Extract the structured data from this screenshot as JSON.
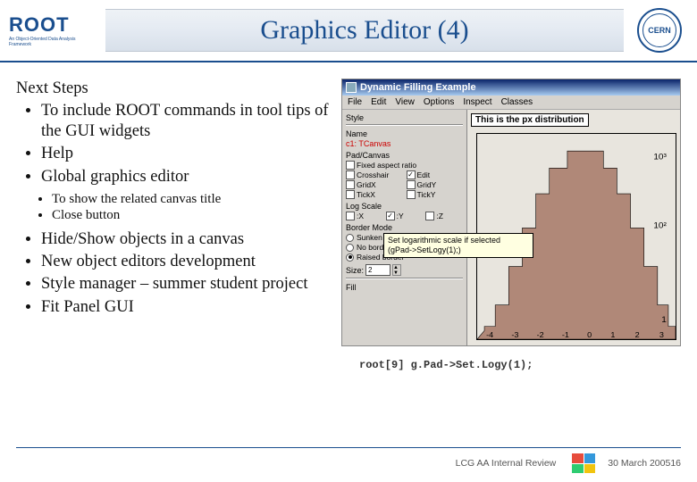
{
  "header": {
    "logo_text": "ROOT",
    "logo_sub": "An Object-Oriented Data Analysis Framework",
    "title": "Graphics Editor (4)",
    "right_logo": "CERN"
  },
  "left": {
    "heading": "Next Steps",
    "bullets": [
      "To include  ROOT commands in tool tips of the GUI widgets",
      "Help",
      "Global graphics editor"
    ],
    "sub_bullets": [
      "To show the related canvas title",
      "Close button"
    ],
    "bullets2": [
      "Hide/Show objects in a canvas",
      "New object editors development",
      "Style manager – summer student project",
      "Fit Panel GUI"
    ]
  },
  "app": {
    "title": "Dynamic Filling Example",
    "menus": [
      "File",
      "Edit",
      "View",
      "Options",
      "Inspect",
      "Classes"
    ],
    "side": {
      "style_label": "Style",
      "name_label": "Name",
      "name_value": "c1: TCanvas",
      "pad_label": "Pad/Canvas",
      "fixed_aspect": "Fixed aspect ratio",
      "crosshair": "Crosshair",
      "edit": "Edit",
      "gridx": "GridX",
      "gridy": "GridY",
      "tickx": "TickX",
      "ticky": "TickY",
      "log_label": "Log Scale",
      "logx": ":X",
      "logy": ":Y",
      "logz": ":Z",
      "border_label": "Border Mode",
      "sunken": "Sunken border",
      "noborder": "No border",
      "raised": "Raised border",
      "size_label": "Size:",
      "size_value": "2",
      "fill_label": "Fill"
    },
    "canvas_title": "This is the px distribution",
    "tooltip": {
      "line1": "Set logarithmic scale if selected",
      "line2": "(gPad->SetLogy(1);)"
    }
  },
  "code_line": "root[9]  g.Pad->Set.Logy(1);",
  "footer": {
    "review": "LCG AA Internal Review",
    "logo_label": "LCG",
    "date": "30 March 2005",
    "page": "16"
  },
  "chart_data": {
    "type": "bar",
    "title": "This is the px distribution",
    "xlabel": "",
    "ylabel": "",
    "xlim": [
      -4,
      4
    ],
    "ylim_log": [
      1,
      1000
    ],
    "y_ticks": [
      "1",
      "10²",
      "10³"
    ],
    "x_ticks": [
      -4,
      -3,
      -2,
      -1,
      0,
      1,
      2,
      3
    ],
    "categories": [
      -3.5,
      -3.0,
      -2.5,
      -2.0,
      -1.5,
      -1.0,
      -0.5,
      0.0,
      0.5,
      1.0,
      1.5,
      2.0,
      2.5,
      3.0,
      3.5
    ],
    "values": [
      3,
      12,
      45,
      130,
      320,
      620,
      900,
      1000,
      900,
      620,
      320,
      130,
      45,
      12,
      3
    ]
  }
}
